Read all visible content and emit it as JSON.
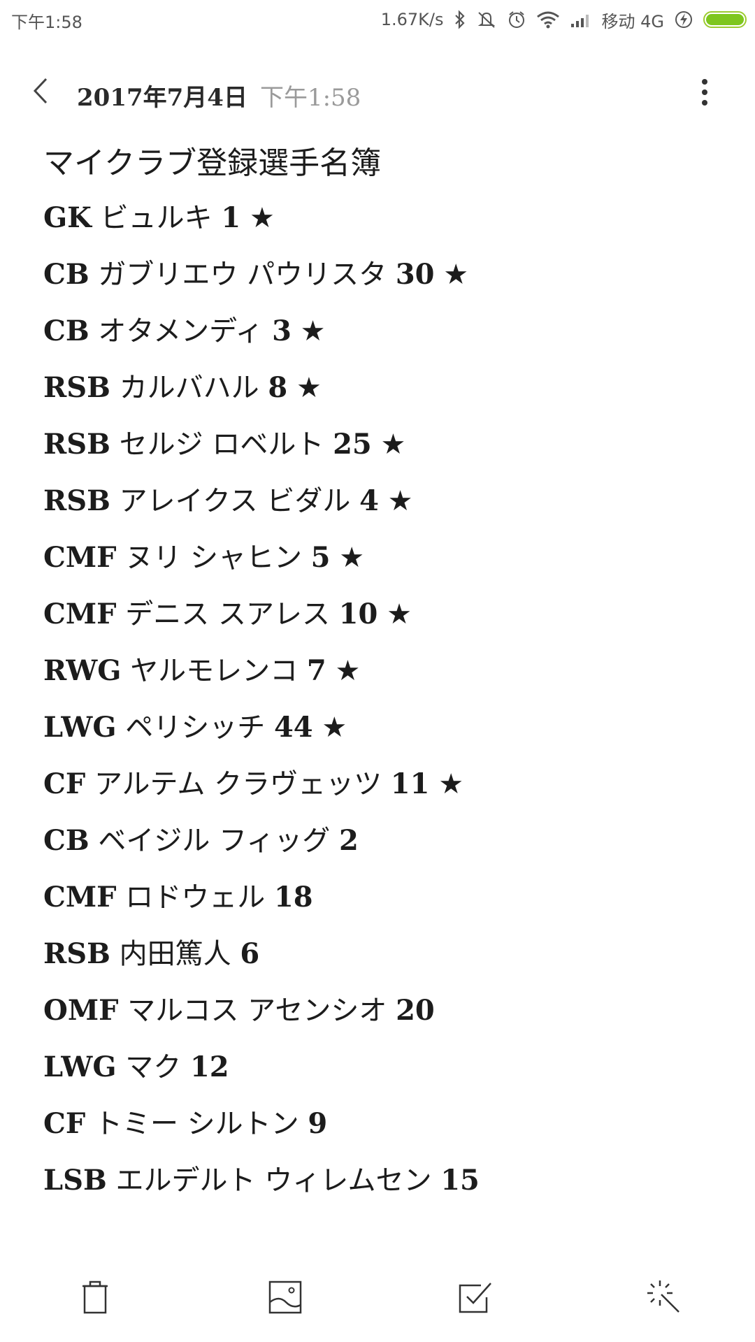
{
  "status_bar": {
    "time": "下午1:58",
    "net_speed": "1.67K/s",
    "carrier": "移动 4G",
    "icons": [
      "bluetooth-icon",
      "mute-vibrate-icon",
      "alarm-icon",
      "wifi-icon",
      "signal-icon",
      "charging-icon",
      "battery-icon"
    ],
    "battery_level": 1.0,
    "battery_color": "#7ec61e"
  },
  "header": {
    "date": "2017年7月4日",
    "time": "下午1:58",
    "back_icon": "chevron-left-icon",
    "more_icon": "more-vertical-icon"
  },
  "note": {
    "title": "マイクラブ登録選手名簿",
    "lines": [
      {
        "pos": "GK",
        "name": "ビュルキ",
        "num": "1",
        "star": "★"
      },
      {
        "pos": "CB",
        "name": "ガブリエウ パウリスタ",
        "num": "30",
        "star": "★"
      },
      {
        "pos": "CB",
        "name": "オタメンディ",
        "num": "3",
        "star": "★"
      },
      {
        "pos": "RSB",
        "name": "カルバハル",
        "num": "8",
        "star": "★"
      },
      {
        "pos": "RSB",
        "name": "セルジ ロベルト",
        "num": "25",
        "star": "★"
      },
      {
        "pos": "RSB",
        "name": "アレイクス ビダル",
        "num": "4",
        "star": "★"
      },
      {
        "pos": "CMF",
        "name": "ヌリ シャヒン",
        "num": "5",
        "star": "★"
      },
      {
        "pos": "CMF",
        "name": "デニス スアレス",
        "num": "10",
        "star": "★"
      },
      {
        "pos": "RWG",
        "name": "ヤルモレンコ",
        "num": "7",
        "star": "★"
      },
      {
        "pos": "LWG",
        "name": "ペリシッチ",
        "num": "44",
        "star": "★"
      },
      {
        "pos": "CF",
        "name": "アルテム クラヴェッツ",
        "num": "11",
        "star": "★"
      },
      {
        "pos": "CB",
        "name": "ベイジル フィッグ",
        "num": "2",
        "star": ""
      },
      {
        "pos": "CMF",
        "name": "ロドウェル",
        "num": "18",
        "star": ""
      },
      {
        "pos": "RSB",
        "name": "内田篤人",
        "num": "6",
        "star": ""
      },
      {
        "pos": "OMF",
        "name": "マルコス アセンシオ",
        "num": "20",
        "star": ""
      },
      {
        "pos": "LWG",
        "name": "マク",
        "num": "12",
        "star": ""
      },
      {
        "pos": "CF",
        "name": "トミー シルトン",
        "num": "9",
        "star": ""
      },
      {
        "pos": "LSB",
        "name": "エルデルト ウィレムセン",
        "num": "15",
        "star": ""
      }
    ]
  },
  "toolbar": {
    "items": [
      {
        "icon": "trash-icon"
      },
      {
        "icon": "image-icon"
      },
      {
        "icon": "checkbox-icon"
      },
      {
        "icon": "magic-wand-icon"
      }
    ]
  }
}
